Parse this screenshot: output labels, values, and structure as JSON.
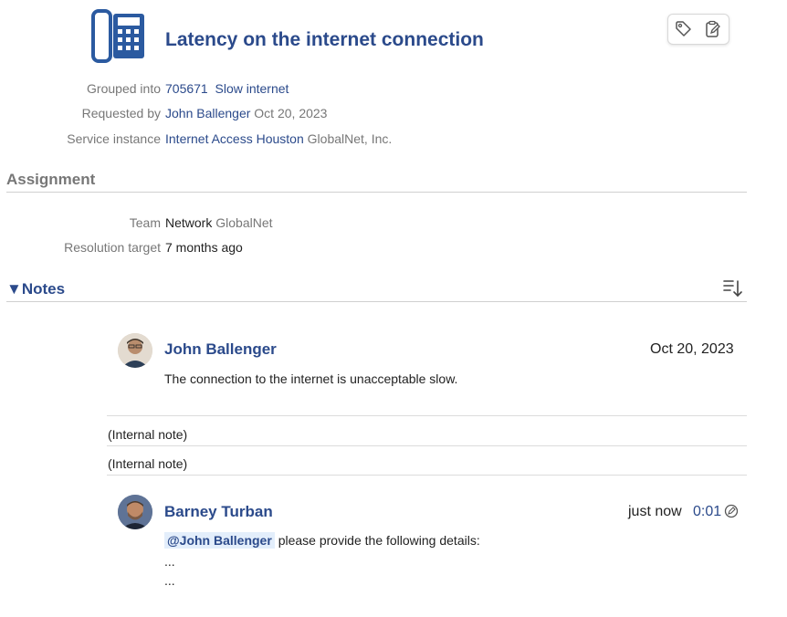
{
  "ticket": {
    "title": "Latency on the internet connection",
    "icon": "phone-icon"
  },
  "toolbar": {
    "tag_icon": "tag-icon",
    "clipboard_icon": "clipboard-edit-icon"
  },
  "details": {
    "grouped_label": "Grouped into",
    "grouped_id": "705671",
    "grouped_name": "Slow internet",
    "requested_label": "Requested by",
    "requested_name": "John Ballenger",
    "requested_date": "Oct 20, 2023",
    "service_label": "Service instance",
    "service_name": "Internet Access Houston",
    "service_provider": "GlobalNet, Inc."
  },
  "assignment": {
    "heading": "Assignment",
    "team_label": "Team",
    "team_value": "Network",
    "team_org": "GlobalNet",
    "resolution_label": "Resolution target",
    "resolution_value": "7 months ago"
  },
  "notes": {
    "heading": "▼Notes",
    "sort_icon": "sort-descending-icon",
    "items": [
      {
        "author": "John Ballenger",
        "date": "Oct 20, 2023",
        "text": "The connection to the internet is unacceptable slow."
      }
    ],
    "internal_1": "(Internal note)",
    "internal_2": "(Internal note)",
    "reply": {
      "author": "Barney Turban",
      "time": "just now",
      "timer": "0:01",
      "mention": "@John Ballenger",
      "text": "please provide the following details:",
      "line2": "...",
      "line3": "..."
    }
  },
  "colors": {
    "accent": "#2b4a8b",
    "muted": "#777777",
    "mention_bg": "#e3eefb"
  }
}
